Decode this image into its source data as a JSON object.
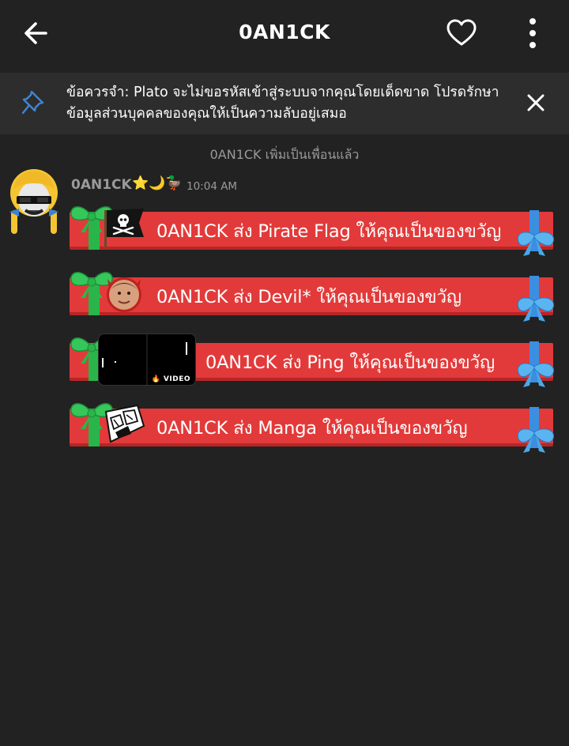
{
  "header": {
    "title": "0AN1CK",
    "back_icon": "arrow-left-icon",
    "favorite_icon": "heart-outline-icon",
    "menu_icon": "more-vertical-icon"
  },
  "notice": {
    "icon": "pin-icon",
    "text": "ข้อควรจำ: Plato จะไม่ขอรหัสเข้าสู่ระบบจากคุณโดยเด็ดขาด โปรดรักษาข้อมูลส่วนบุคคลของคุณให้เป็นความลับอยู่เสมอ",
    "close_icon": "close-icon"
  },
  "system_message": "0AN1CK เพิ่มเป็นเพื่อนแล้ว",
  "message": {
    "sender": "0AN1CK",
    "badges": "⭐🌙🦆",
    "time": "10:04 AM",
    "gifts": [
      {
        "label": "0AN1CK ส่ง Pirate Flag ให้คุณเป็นของขวัญ",
        "icon": "pirate-flag-icon"
      },
      {
        "label": "0AN1CK ส่ง Devil* ให้คุณเป็นของขวัญ",
        "icon": "devil-avatar-icon"
      },
      {
        "label": "0AN1CK ส่ง Ping ให้คุณเป็นของขวัญ",
        "icon": "ping-video-thumbnail",
        "video_tag": "VIDEO"
      },
      {
        "label": "0AN1CK ส่ง Manga ให้คุณเป็นของขวัญ",
        "icon": "manga-icon"
      }
    ]
  },
  "colors": {
    "background": "#222222",
    "notice_bg": "#2d2d2d",
    "gift_red": "#e23a3a",
    "gift_green": "#2ab54a",
    "ribbon_blue": "#4aa8e8",
    "muted_text": "#9a9a9a"
  }
}
